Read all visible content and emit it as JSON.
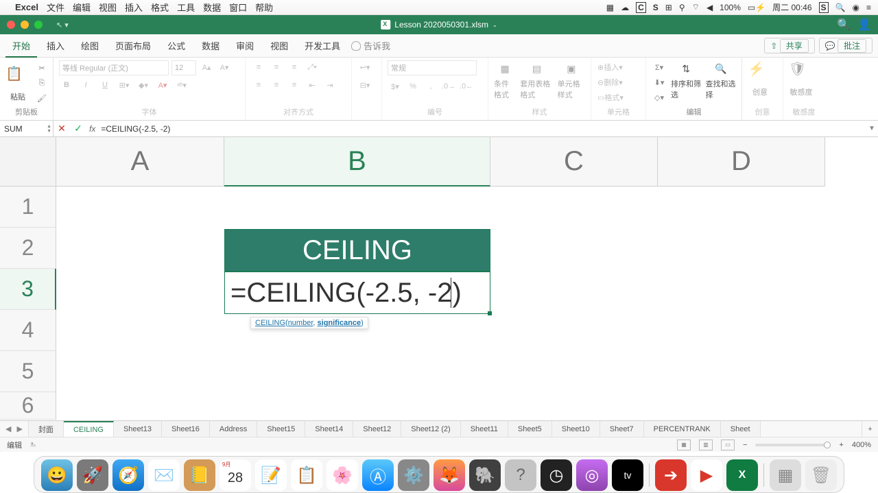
{
  "menubar": {
    "app": "Excel",
    "items": [
      "文件",
      "编辑",
      "视图",
      "插入",
      "格式",
      "工具",
      "数据",
      "窗口",
      "帮助"
    ],
    "battery": "100%",
    "day_time": "周二 00:46"
  },
  "titlebar": {
    "filename": "Lesson 2020050301.xlsm"
  },
  "ribbon_tabs": {
    "items": [
      "开始",
      "插入",
      "绘图",
      "页面布局",
      "公式",
      "数据",
      "审阅",
      "视图",
      "开发工具"
    ],
    "active": "开始",
    "tellme": "告诉我",
    "share": "共享",
    "comments": "批注"
  },
  "ribbon_groups": {
    "clipboard": {
      "paste": "粘贴",
      "label": "剪贴板"
    },
    "font": {
      "name": "等线 Regular (正文)",
      "size": "12",
      "label": "字体",
      "bold": "B",
      "italic": "I",
      "underline": "U"
    },
    "alignment": {
      "label": "对齐方式"
    },
    "number": {
      "format": "常规",
      "label": "编号"
    },
    "styles": {
      "cond": "条件格式",
      "table": "套用表格格式",
      "cell": "单元格样式",
      "label": "样式"
    },
    "cells": {
      "insert": "插入",
      "delete": "删除",
      "format": "格式",
      "label": "单元格"
    },
    "editing": {
      "sort": "排序和筛选",
      "find": "查找和选择",
      "label": "编辑"
    },
    "ideas": {
      "btn": "创意",
      "label": "创意"
    },
    "sensitivity": {
      "btn": "敏感度",
      "label": "敏感度"
    }
  },
  "formula_bar": {
    "name_box": "SUM",
    "formula": "=CEILING(-2.5, -2)"
  },
  "grid": {
    "cols": [
      "A",
      "B",
      "C",
      "D"
    ],
    "rows": [
      "1",
      "2",
      "3",
      "4",
      "5",
      "6"
    ],
    "header_cell": "CEILING",
    "editing_cell": "=CEILING(-2.5, -2)",
    "tooltip": {
      "fn": "CEILING",
      "open": "(",
      "arg1": "number",
      "sep": ", ",
      "arg2": "significance",
      "close": ")"
    }
  },
  "sheets": {
    "items": [
      "封面",
      "CEILING",
      "Sheet13",
      "Sheet16",
      "Address",
      "Sheet15",
      "Sheet14",
      "Sheet12",
      "Sheet12 (2)",
      "Sheet11",
      "Sheet5",
      "Sheet10",
      "Sheet7",
      "PERCENTRANK",
      "Sheet"
    ],
    "active": "CEILING"
  },
  "status": {
    "mode": "编辑",
    "zoom": "400%"
  },
  "dock": {
    "cal_month": "9月",
    "cal_day": "28"
  }
}
